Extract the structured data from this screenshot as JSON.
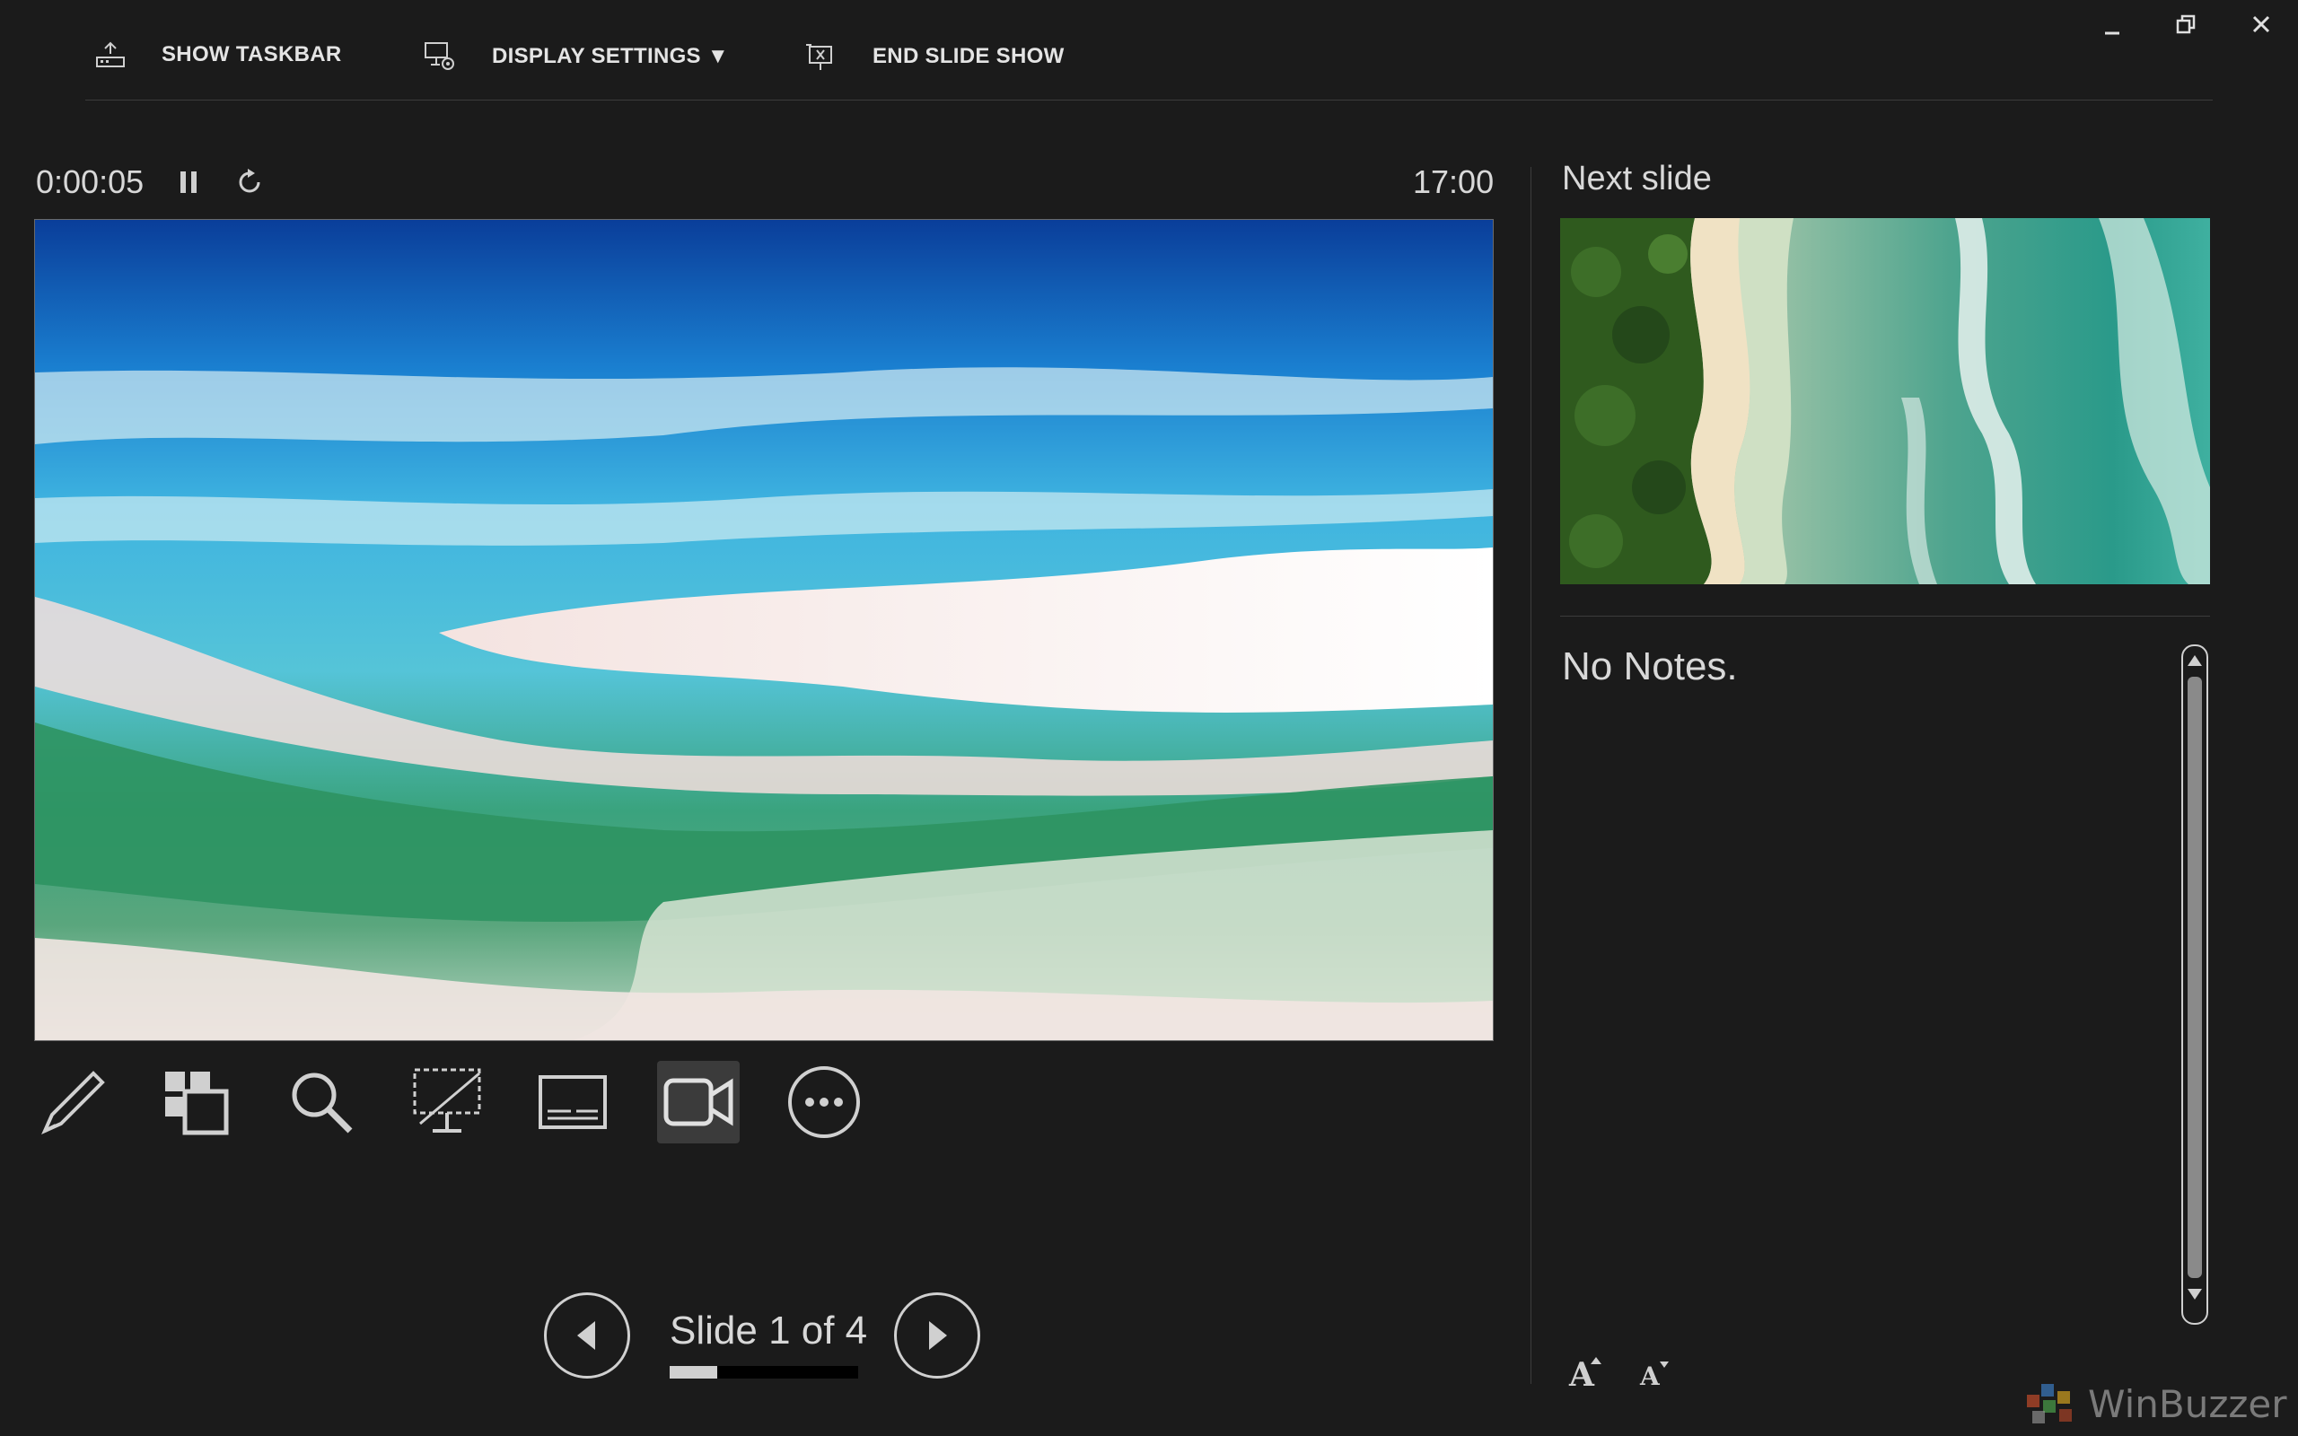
{
  "toolbar": {
    "show_taskbar": "SHOW TASKBAR",
    "display_settings": "DISPLAY SETTINGS ▼",
    "end_slide_show": "END SLIDE SHOW"
  },
  "window_controls": [
    "minimize-icon",
    "restore-icon",
    "close-icon"
  ],
  "timer": {
    "elapsed": "0:00:05",
    "clock": "17:00"
  },
  "next_slide": {
    "title": "Next slide"
  },
  "notes": {
    "text": "No Notes."
  },
  "navigation": {
    "counter": "Slide 1 of 4",
    "current": 1,
    "total": 4
  },
  "tools": [
    "pen-icon",
    "see-all-slides-icon",
    "zoom-icon",
    "black-screen-icon",
    "subtitles-icon",
    "camera-icon",
    "more-options-icon"
  ],
  "watermark": {
    "text": "WinBuzzer"
  },
  "colors": {
    "background": "#1b1b1b",
    "text": "#d6d6d6",
    "active_tool": "#3b3b3b"
  }
}
